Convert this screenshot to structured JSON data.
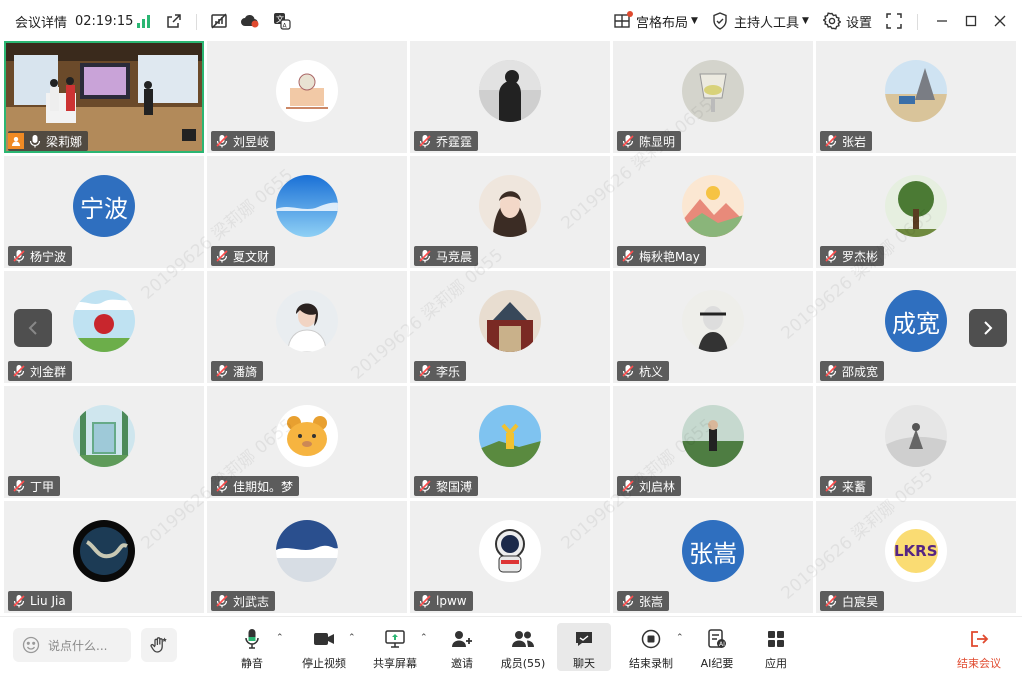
{
  "topbar": {
    "meeting_details": "会议详情",
    "timer": "02:19:15",
    "layout_label": "宫格布局",
    "host_tools_label": "主持人工具",
    "settings_label": "设置"
  },
  "icons": {
    "signal": "signal-bars-icon",
    "popout": "popout-icon",
    "colors": {
      "accent": "#2bb673",
      "end": "#e04a2f",
      "avatar_blue": "#2f6fbf"
    }
  },
  "watermark": "20199626 梁莉娜 0655",
  "participants": [
    {
      "name": "梁莉娜",
      "kind": "video"
    },
    {
      "name": "刘昱岐",
      "kind": "image"
    },
    {
      "name": "乔霆霆",
      "kind": "image"
    },
    {
      "name": "陈显明",
      "kind": "image"
    },
    {
      "name": "张岩",
      "kind": "image"
    },
    {
      "name": "杨宁波",
      "kind": "text",
      "initials": "宁波"
    },
    {
      "name": "夏文财",
      "kind": "image"
    },
    {
      "name": "马竞晨",
      "kind": "image"
    },
    {
      "name": "梅秋艳May",
      "kind": "image"
    },
    {
      "name": "罗杰彬",
      "kind": "image"
    },
    {
      "name": "刘金群",
      "kind": "image"
    },
    {
      "name": "潘旖",
      "kind": "image"
    },
    {
      "name": "李乐",
      "kind": "image"
    },
    {
      "name": "杭义",
      "kind": "image"
    },
    {
      "name": "邵成宽",
      "kind": "text",
      "initials": "成宽"
    },
    {
      "name": "丁甲",
      "kind": "image"
    },
    {
      "name": "佳期如。梦",
      "kind": "image"
    },
    {
      "name": "黎国溥",
      "kind": "image"
    },
    {
      "name": "刘启林",
      "kind": "image"
    },
    {
      "name": "来蓄",
      "kind": "image"
    },
    {
      "name": "Liu Jia",
      "kind": "image"
    },
    {
      "name": "刘武志",
      "kind": "image"
    },
    {
      "name": "lpww",
      "kind": "image"
    },
    {
      "name": "张嵩",
      "kind": "text",
      "initials": "张嵩"
    },
    {
      "name": "白宸昊",
      "kind": "image"
    }
  ],
  "bottombar": {
    "chat_placeholder": "说点什么...",
    "mute": "静音",
    "stop_video": "停止视频",
    "share_screen": "共享屏幕",
    "invite": "邀请",
    "members": "成员(55)",
    "chat": "聊天",
    "end_recording": "结束录制",
    "ai_minutes": "AI纪要",
    "apps": "应用",
    "end_meeting": "结束会议"
  }
}
